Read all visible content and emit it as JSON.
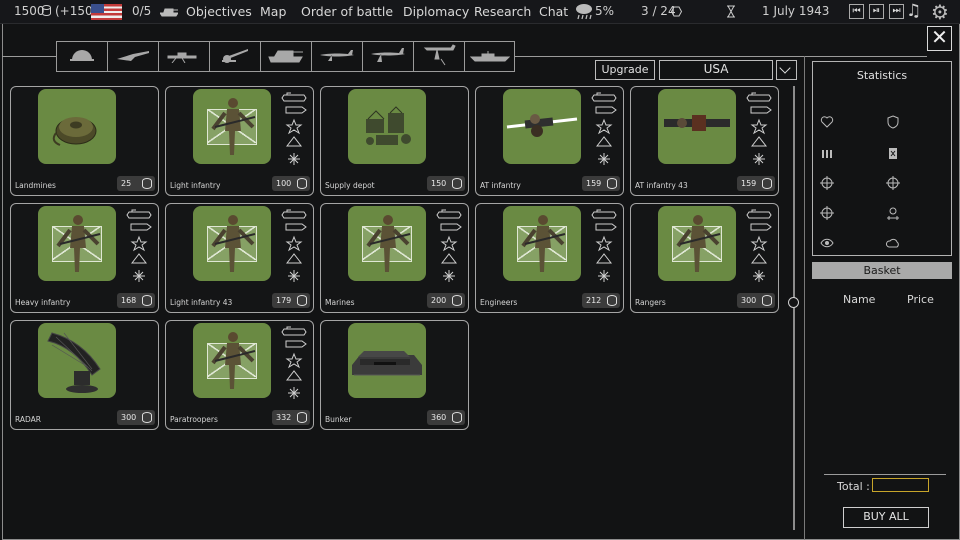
{
  "topbar": {
    "money": "1500",
    "income": "(+150)",
    "count": "0/5",
    "menu": [
      "Objectives",
      "Map",
      "Order of battle",
      "Diplomacy",
      "Research",
      "Chat"
    ],
    "weather_pct": "5%",
    "turn": "3 / 24",
    "date": "1 July 1943"
  },
  "shop": {
    "upgrade_label": "Upgrade",
    "country": "USA",
    "tabs": [
      "helmet-icon",
      "rifle-icon",
      "machine-gun-icon",
      "artillery-icon",
      "tank-icon",
      "fighter-plane-icon",
      "bomber-icon",
      "ground-attack-plane-icon",
      "ship-icon"
    ],
    "units": [
      {
        "name": "Landmines",
        "cost": "25",
        "art": "mine"
      },
      {
        "name": "Light infantry",
        "cost": "100",
        "art": "soldier"
      },
      {
        "name": "Supply depot",
        "cost": "150",
        "art": "depot"
      },
      {
        "name": "AT infantry",
        "cost": "159",
        "art": "bazooka"
      },
      {
        "name": "AT infantry 43",
        "cost": "159",
        "art": "bazooka2"
      },
      {
        "name": "Heavy infantry",
        "cost": "168",
        "art": "soldier"
      },
      {
        "name": "Light infantry 43",
        "cost": "179",
        "art": "soldier"
      },
      {
        "name": "Marines",
        "cost": "200",
        "art": "soldier"
      },
      {
        "name": "Engineers",
        "cost": "212",
        "art": "soldier"
      },
      {
        "name": "Rangers",
        "cost": "300",
        "art": "soldier"
      },
      {
        "name": "RADAR",
        "cost": "300",
        "art": "radar"
      },
      {
        "name": "Paratroopers",
        "cost": "332",
        "art": "soldier"
      },
      {
        "name": "Bunker",
        "cost": "360",
        "art": "bunker"
      }
    ]
  },
  "stats": {
    "title": "Statistics",
    "icons": [
      "heart-icon",
      "armor-icon",
      "ammo-icon",
      "fuel-icon",
      "crosshair-icon",
      "crosshair-armored-icon",
      "crosshair-air-icon",
      "movement-icon",
      "vision-icon",
      "cloud-icon"
    ]
  },
  "basket": {
    "title": "Basket",
    "col_name": "Name",
    "col_price": "Price",
    "total_label": "Total :",
    "buy_all": "BUY ALL"
  }
}
